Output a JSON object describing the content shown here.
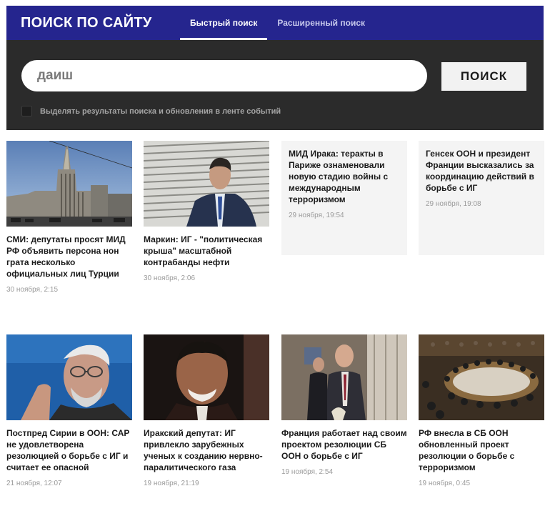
{
  "search": {
    "title": "ПОИСК ПО САЙТУ",
    "tabs": [
      {
        "label": "Быстрый поиск",
        "active": true
      },
      {
        "label": "Расширенный поиск",
        "active": false
      }
    ],
    "query": "даиш",
    "button_label": "ПОИСК",
    "checkbox_label": "Выделять результаты поиска и обновления в ленте событий",
    "checkbox_checked": false
  },
  "results": [
    {
      "title": "СМИ: депутаты просят МИД РФ объявить персона нон грата несколько официальных лиц Турции",
      "date": "30 ноября, 2:15"
    },
    {
      "title": "Маркин: ИГ - \"политическая крыша\" масштабной контрабанды нефти",
      "date": "30 ноября, 2:06"
    },
    {
      "title": "МИД Ирака: теракты в Париже ознаменовали новую стадию войны с международным терроризмом",
      "date": "29 ноября, 19:54"
    },
    {
      "title": "Генсек ООН и президент Франции высказались за координацию действий в борьбе с ИГ",
      "date": "29 ноября, 19:08"
    },
    {
      "title": "Постпред Сирии в ООН: САР не удовлетворена резолюцией о борьбе с ИГ и считает ее опасной",
      "date": "21 ноября, 12:07"
    },
    {
      "title": "Иракский депутат: ИГ привлекло зарубежных ученых к созданию нервно-паралитического газа",
      "date": "19 ноября, 21:19"
    },
    {
      "title": "Франция работает над своим проектом резолюции СБ ООН о борьбе с ИГ",
      "date": "19 ноября, 2:54"
    },
    {
      "title": "РФ внесла в СБ ООН обновленный проект резолюции о борьбе с терроризмом",
      "date": "19 ноября, 0:45"
    }
  ],
  "colors": {
    "header_bg": "#25258e",
    "panel_bg": "#2b2b2b",
    "date_text": "#9a9a9a"
  }
}
